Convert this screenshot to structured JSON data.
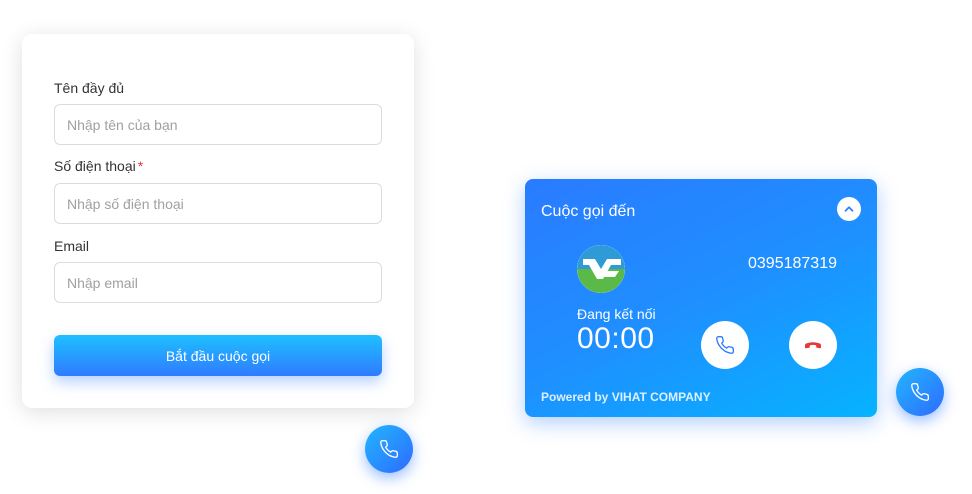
{
  "form": {
    "name_label": "Tên đầy đủ",
    "name_placeholder": "Nhập tên của bạn",
    "phone_label": "Số điện thoại",
    "phone_required_mark": "*",
    "phone_placeholder": "Nhập số điện thoại",
    "email_label": "Email",
    "email_placeholder": "Nhập email",
    "submit_label": "Bắt đầu cuộc gọi"
  },
  "call": {
    "title": "Cuộc gọi đến",
    "phone_number": "0395187319",
    "status": "Đang kết nối",
    "timer": "00:00",
    "powered_by": "Powered by VIHAT COMPANY"
  },
  "icons": {
    "phone": "phone-icon",
    "hangup": "hangup-icon",
    "collapse": "chevron-up-icon",
    "logo": "vihat-logo-icon"
  },
  "colors": {
    "accent": "#2f7bff",
    "accent_light": "#1ec0ff",
    "hangup": "#e53935"
  }
}
